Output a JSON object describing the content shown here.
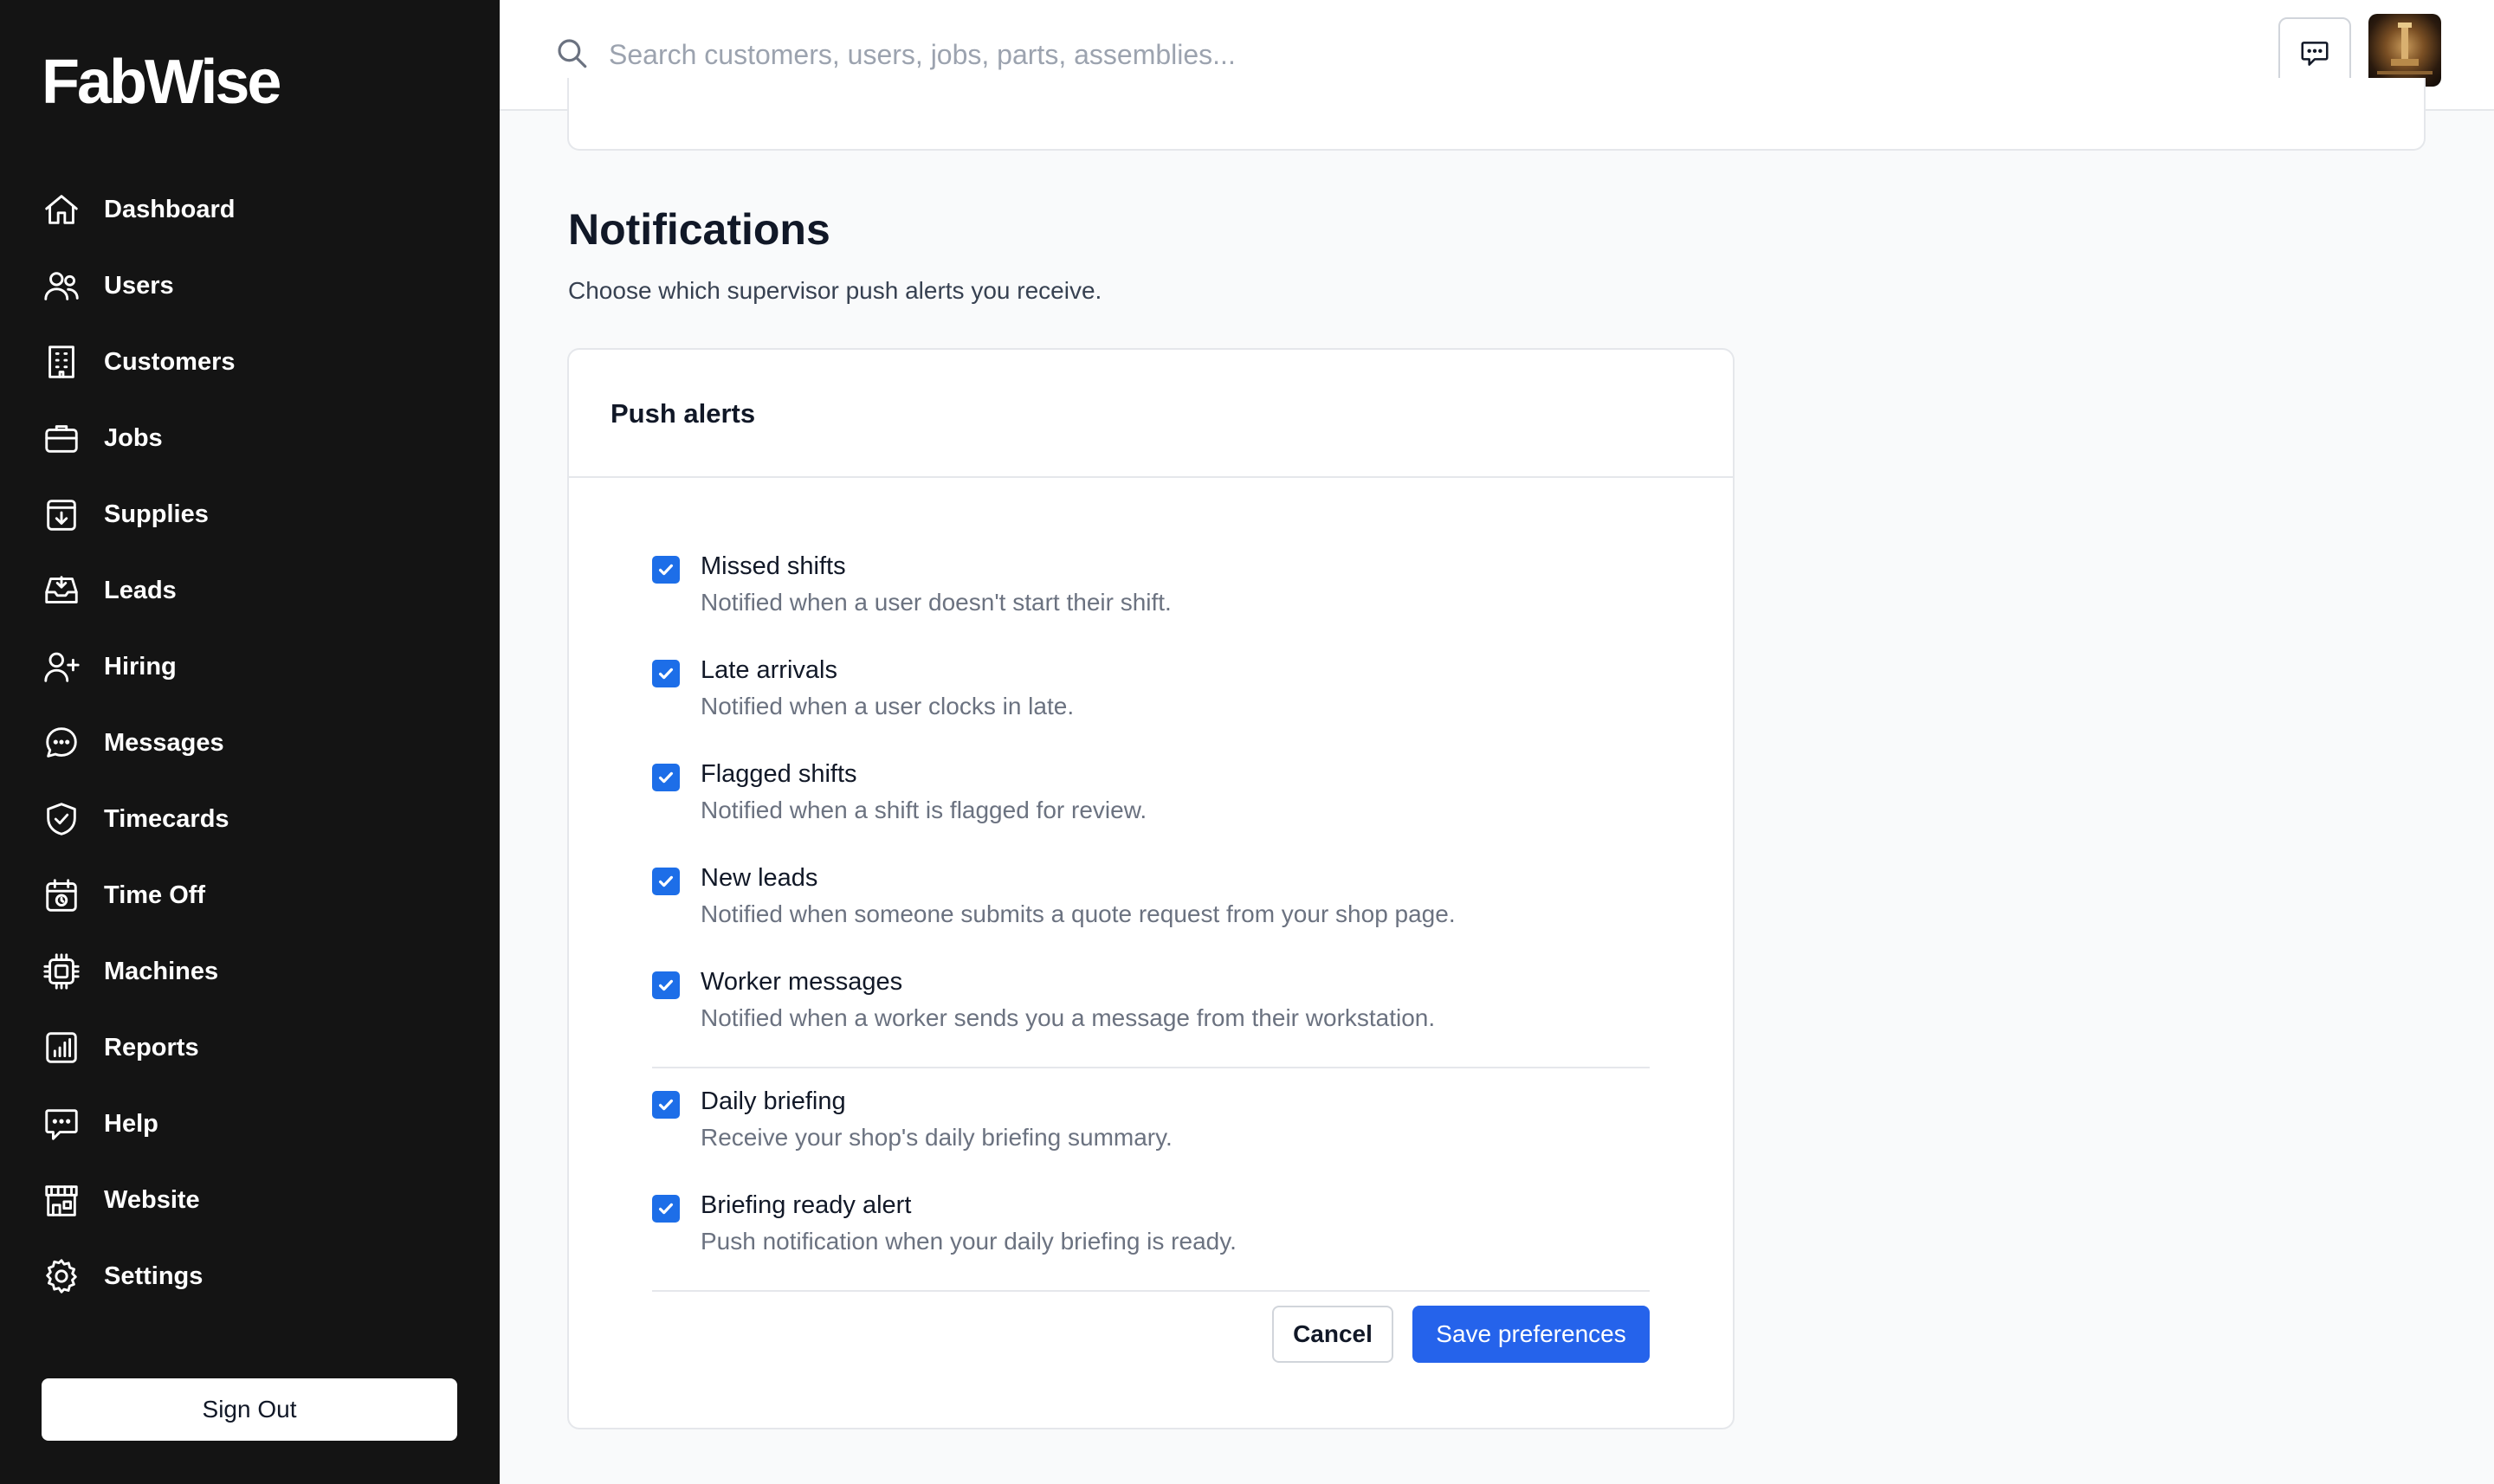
{
  "app": {
    "logo": "FabWise"
  },
  "sidebar": {
    "items": [
      {
        "label": "Dashboard",
        "icon": "home-icon"
      },
      {
        "label": "Users",
        "icon": "users-icon"
      },
      {
        "label": "Customers",
        "icon": "building-icon"
      },
      {
        "label": "Jobs",
        "icon": "briefcase-icon"
      },
      {
        "label": "Supplies",
        "icon": "package-download-icon"
      },
      {
        "label": "Leads",
        "icon": "inbox-icon"
      },
      {
        "label": "Hiring",
        "icon": "user-plus-icon"
      },
      {
        "label": "Messages",
        "icon": "chat-bubble-icon"
      },
      {
        "label": "Timecards",
        "icon": "shield-check-icon"
      },
      {
        "label": "Time Off",
        "icon": "calendar-clock-icon"
      },
      {
        "label": "Machines",
        "icon": "cpu-icon"
      },
      {
        "label": "Reports",
        "icon": "bar-chart-icon"
      },
      {
        "label": "Help",
        "icon": "help-chat-icon"
      },
      {
        "label": "Website",
        "icon": "storefront-icon"
      },
      {
        "label": "Settings",
        "icon": "gear-icon"
      }
    ],
    "signout_label": "Sign Out"
  },
  "header": {
    "search": {
      "placeholder": "Search customers, users, jobs, parts, assemblies..."
    }
  },
  "main": {
    "title": "Notifications",
    "subtitle": "Choose which supervisor push alerts you receive.",
    "card": {
      "title": "Push alerts",
      "preferences": [
        {
          "label": "Missed shifts",
          "description": "Notified when a user doesn't start their shift.",
          "checked": true
        },
        {
          "label": "Late arrivals",
          "description": "Notified when a user clocks in late.",
          "checked": true
        },
        {
          "label": "Flagged shifts",
          "description": "Notified when a shift is flagged for review.",
          "checked": true
        },
        {
          "label": "New leads",
          "description": "Notified when someone submits a quote request from your shop page.",
          "checked": true
        },
        {
          "label": "Worker messages",
          "description": "Notified when a worker sends you a message from their workstation.",
          "checked": true
        },
        {
          "label": "Daily briefing",
          "description": "Receive your shop's daily briefing summary.",
          "checked": true
        },
        {
          "label": "Briefing ready alert",
          "description": "Push notification when your daily briefing is ready.",
          "checked": true
        }
      ],
      "cancel_label": "Cancel",
      "save_label": "Save preferences"
    }
  },
  "colors": {
    "sidebar_bg": "#141414",
    "accent": "#2563eb",
    "checkbox": "#1d6ee8"
  }
}
